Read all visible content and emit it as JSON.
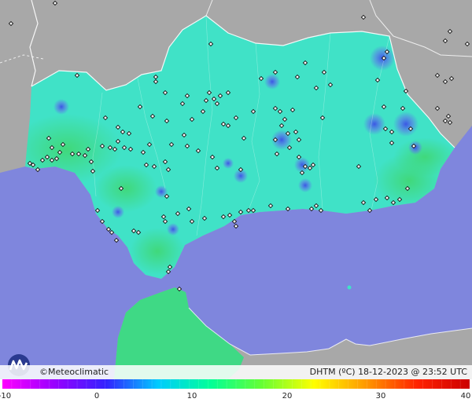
{
  "credit": "Meteoclimatic",
  "stamp": "DHTM (ºC)  18-12-2023 @ 23:52 UTC",
  "scale": {
    "ticks": [
      "-10",
      "0",
      "10",
      "20",
      "30",
      "40"
    ],
    "colors": [
      "#ff00ff",
      "#9900ff",
      "#3322ff",
      "#00ccff",
      "#00ff99",
      "#66ff33",
      "#ffff00",
      "#ff9900",
      "#ff2200",
      "#cc0000"
    ]
  },
  "palette": {
    "sea": "#7f86dd",
    "land": "#a6a6a6",
    "region": "#3fe3c9",
    "region_warm": "#3fdf80",
    "cold_spot": "#5a6ae8"
  }
}
